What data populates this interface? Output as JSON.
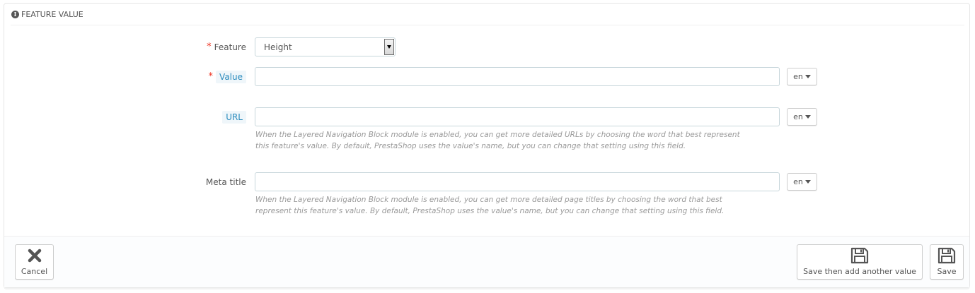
{
  "panel": {
    "heading": "FEATURE VALUE",
    "heading_icon": "info-circle-icon"
  },
  "form": {
    "feature": {
      "label": "Feature",
      "required_mark": "*",
      "selected_value": "Height"
    },
    "value": {
      "label": "Value",
      "required_mark": "*",
      "input_value": "",
      "lang": "en"
    },
    "url": {
      "label": "URL",
      "input_value": "",
      "lang": "en",
      "help_line1": "When the Layered Navigation Block module is enabled, you can get more detailed URLs by choosing the word that best represent",
      "help_line2": "this feature's value. By default, PrestaShop uses the value's name, but you can change that setting using this field."
    },
    "meta_title": {
      "label": "Meta title",
      "input_value": "",
      "lang": "en",
      "help_line1": "When the Layered Navigation Block module is enabled, you can get more detailed page titles by choosing the word that best",
      "help_line2": "represent this feature's value. By default, PrestaShop uses the value's name, but you can change that setting using this field."
    }
  },
  "footer": {
    "cancel_label": "Cancel",
    "cancel_icon": "close-icon",
    "save_add_label": "Save then add another value",
    "save_add_icon": "save-icon",
    "save_label": "Save",
    "save_icon": "save-icon"
  },
  "colors": {
    "required": "#ee3322",
    "hint_text": "#2a8bbd",
    "hint_bg": "#eff6fa",
    "help_text": "#999999"
  }
}
